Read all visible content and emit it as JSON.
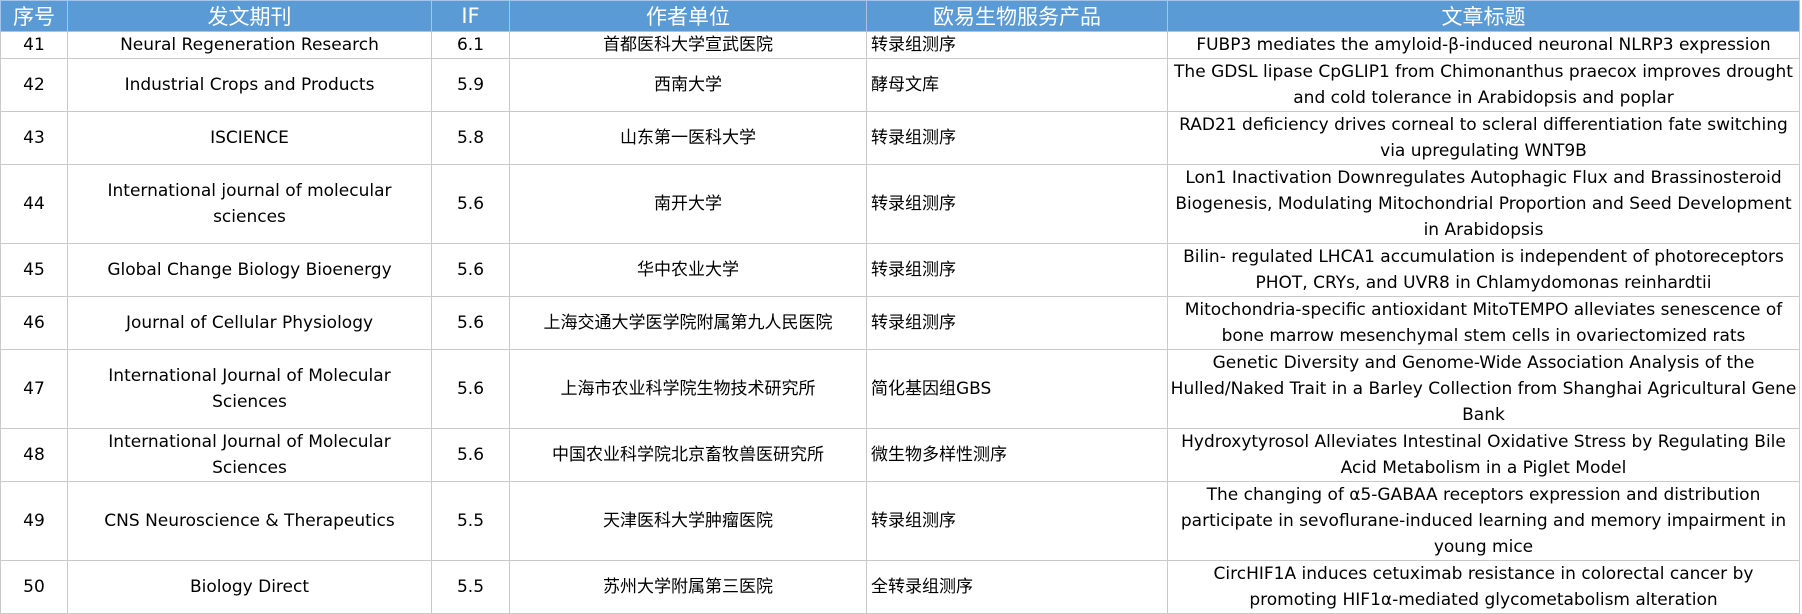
{
  "header": {
    "idx": "序号",
    "journal": "发文期刊",
    "if": "IF",
    "org": "作者单位",
    "product": "欧易生物服务产品",
    "title": "文章标题"
  },
  "rows": [
    {
      "idx": "41",
      "journal": "Neural Regeneration Research",
      "if": "6.1",
      "org": "首都医科大学宣武医院",
      "product": "转录组测序",
      "title": "FUBP3 mediates the amyloid-β-induced neuronal NLRP3 expression"
    },
    {
      "idx": "42",
      "journal": "Industrial Crops and Products",
      "if": "5.9",
      "org": "西南大学",
      "product": "酵母文库",
      "title": "The GDSL lipase CpGLIP1 from Chimonanthus praecox improves drought and cold tolerance in Arabidopsis and poplar"
    },
    {
      "idx": "43",
      "journal": "ISCIENCE",
      "if": "5.8",
      "org": "山东第一医科大学",
      "product": "转录组测序",
      "title": "RAD21 deficiency drives corneal to scleral differentiation fate switching via upregulating WNT9B"
    },
    {
      "idx": "44",
      "journal": "International journal of molecular sciences",
      "if": "5.6",
      "org": "南开大学",
      "product": "转录组测序",
      "title": "Lon1 Inactivation Downregulates Autophagic Flux and Brassinosteroid Biogenesis, Modulating Mitochondrial Proportion and Seed Development in Arabidopsis"
    },
    {
      "idx": "45",
      "journal": "Global Change Biology Bioenergy",
      "if": "5.6",
      "org": "华中农业大学",
      "product": "转录组测序",
      "title": "Bilin- regulated LHCA1 accumulation is independent of photoreceptors PHOT, CRYs, and UVR8 in Chlamydomonas reinhardtii"
    },
    {
      "idx": "46",
      "journal": "Journal of Cellular Physiology",
      "if": "5.6",
      "org": "上海交通大学医学院附属第九人民医院",
      "product": "转录组测序",
      "title": "Mitochondria-specific antioxidant MitoTEMPO alleviates senescence of bone marrow mesenchymal stem cells in ovariectomized rats"
    },
    {
      "idx": "47",
      "journal": "International Journal of Molecular Sciences",
      "if": "5.6",
      "org": "上海市农业科学院生物技术研究所",
      "product": "简化基因组GBS",
      "title": "Genetic Diversity and Genome-Wide Association Analysis of the Hulled/Naked Trait in a Barley Collection from Shanghai Agricultural Gene Bank"
    },
    {
      "idx": "48",
      "journal": "International Journal of Molecular Sciences",
      "if": "5.6",
      "org": "中国农业科学院北京畜牧兽医研究所",
      "product": "微生物多样性测序",
      "title": "Hydroxytyrosol Alleviates Intestinal Oxidative Stress by Regulating Bile Acid Metabolism in a Piglet Model"
    },
    {
      "idx": "49",
      "journal": "CNS Neuroscience & Therapeutics",
      "if": "5.5",
      "org": "天津医科大学肿瘤医院",
      "product": "转录组测序",
      "title": "The changing of α5-GABAA receptors expression and distribution participate in sevoflurane-induced learning and memory impairment in young mice"
    },
    {
      "idx": "50",
      "journal": "Biology Direct",
      "if": "5.5",
      "org": "苏州大学附属第三医院",
      "product": "全转录组测序",
      "title": "CircHIF1A induces cetuximab resistance in colorectal cancer by promoting HIF1α-mediated glycometabolism alteration"
    }
  ],
  "colors": {
    "header_bg": "#5b9bd5",
    "header_text": "#ffffff",
    "grid": "#c9c9c9"
  }
}
